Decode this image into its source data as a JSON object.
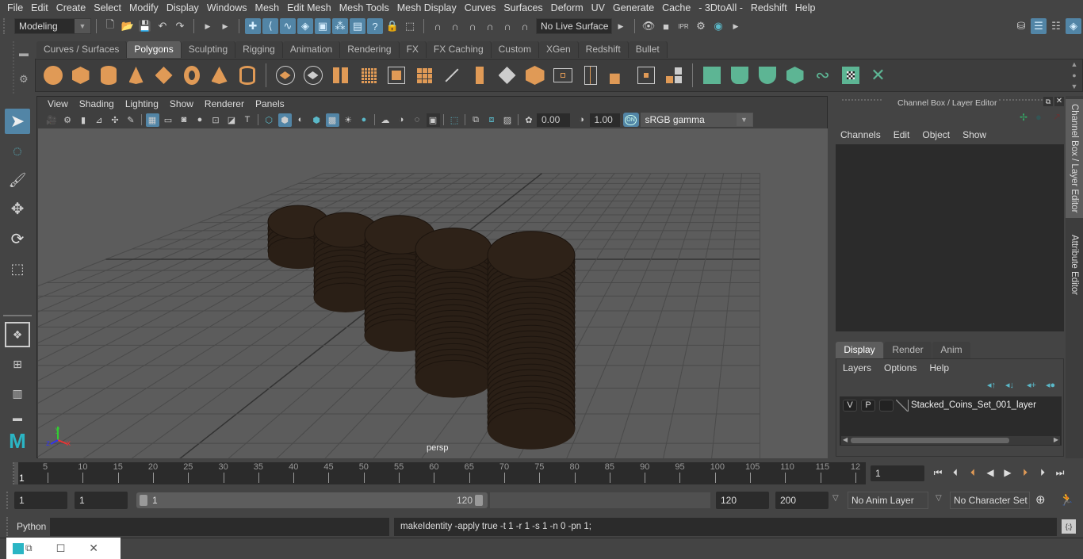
{
  "menubar": [
    "File",
    "Edit",
    "Create",
    "Select",
    "Modify",
    "Display",
    "Windows",
    "Mesh",
    "Edit Mesh",
    "Mesh Tools",
    "Mesh Display",
    "Curves",
    "Surfaces",
    "Deform",
    "UV",
    "Generate",
    "Cache",
    "- 3DtoAll -",
    "Redshift",
    "Help"
  ],
  "statusline": {
    "mode": "Modeling",
    "live_surface": "No Live Surface"
  },
  "shelf": {
    "tabs": [
      "Curves / Surfaces",
      "Polygons",
      "Sculpting",
      "Rigging",
      "Animation",
      "Rendering",
      "FX",
      "FX Caching",
      "Custom",
      "XGen",
      "Redshift",
      "Bullet"
    ],
    "active_tab": "Polygons"
  },
  "viewport": {
    "menu": [
      "View",
      "Shading",
      "Lighting",
      "Show",
      "Renderer",
      "Panels"
    ],
    "exposure": "0.00",
    "gamma": "1.00",
    "color_toggle": "ON",
    "colorspace": "sRGB gamma",
    "camera_label": "persp",
    "axis": {
      "x": "x",
      "y": "y",
      "z": "z"
    }
  },
  "channel_box": {
    "title": "Channel Box / Layer Editor",
    "menu": [
      "Channels",
      "Edit",
      "Object",
      "Show"
    ],
    "side_tabs": [
      "Channel Box / Layer Editor",
      "Attribute Editor"
    ]
  },
  "layer_editor": {
    "tabs": [
      "Display",
      "Render",
      "Anim"
    ],
    "active_tab": "Display",
    "menu": [
      "Layers",
      "Options",
      "Help"
    ],
    "layers": [
      {
        "visible": "V",
        "playback": "P",
        "name": "Stacked_Coins_Set_001_layer"
      }
    ]
  },
  "timeline": {
    "ticks": [
      "5",
      "10",
      "15",
      "20",
      "25",
      "30",
      "35",
      "40",
      "45",
      "50",
      "55",
      "60",
      "65",
      "70",
      "75",
      "80",
      "85",
      "90",
      "95",
      "100",
      "105",
      "110",
      "115",
      "12"
    ],
    "current_marker": "1",
    "current_frame": "1"
  },
  "range": {
    "start": "1",
    "start2": "1",
    "slider_start": "1",
    "slider_end": "120",
    "end": "120",
    "end2": "200",
    "anim_layer": "No Anim Layer",
    "character_set": "No Character Set"
  },
  "command": {
    "lang": "Python",
    "input": "",
    "result": "makeIdentity -apply true -t 1 -r 1 -s 1 -n 0 -pn 1;"
  },
  "colors": {
    "accent_blue": "#5285a6",
    "shelf_orange": "#e09a56",
    "shelf_green": "#5db594",
    "coin": "#2e2218"
  }
}
